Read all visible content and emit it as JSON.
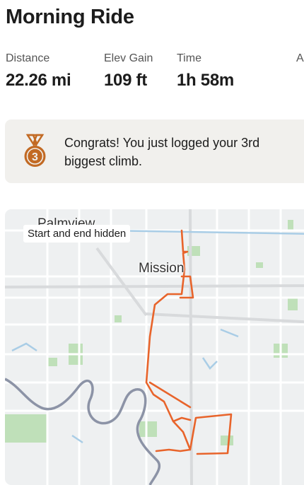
{
  "activity": {
    "title": "Morning Ride"
  },
  "stats": [
    {
      "label": "Distance",
      "value": "22.26 mi"
    },
    {
      "label": "Elev Gain",
      "value": "109 ft"
    },
    {
      "label": "Time",
      "value": "1h 58m"
    },
    {
      "label": "A",
      "value": ""
    }
  ],
  "achievement": {
    "medal_number": "3",
    "text": "Congrats! You just logged your 3rd biggest climb.",
    "medal_color": "#c26a24"
  },
  "map": {
    "badge": "Start and end hidden",
    "city_label": "Mission",
    "partial_label": "Palmview",
    "route_color": "#e8642b",
    "river_color": "#8c93a6",
    "water_color": "#a9cde6",
    "park_color": "#bfe0b9"
  }
}
